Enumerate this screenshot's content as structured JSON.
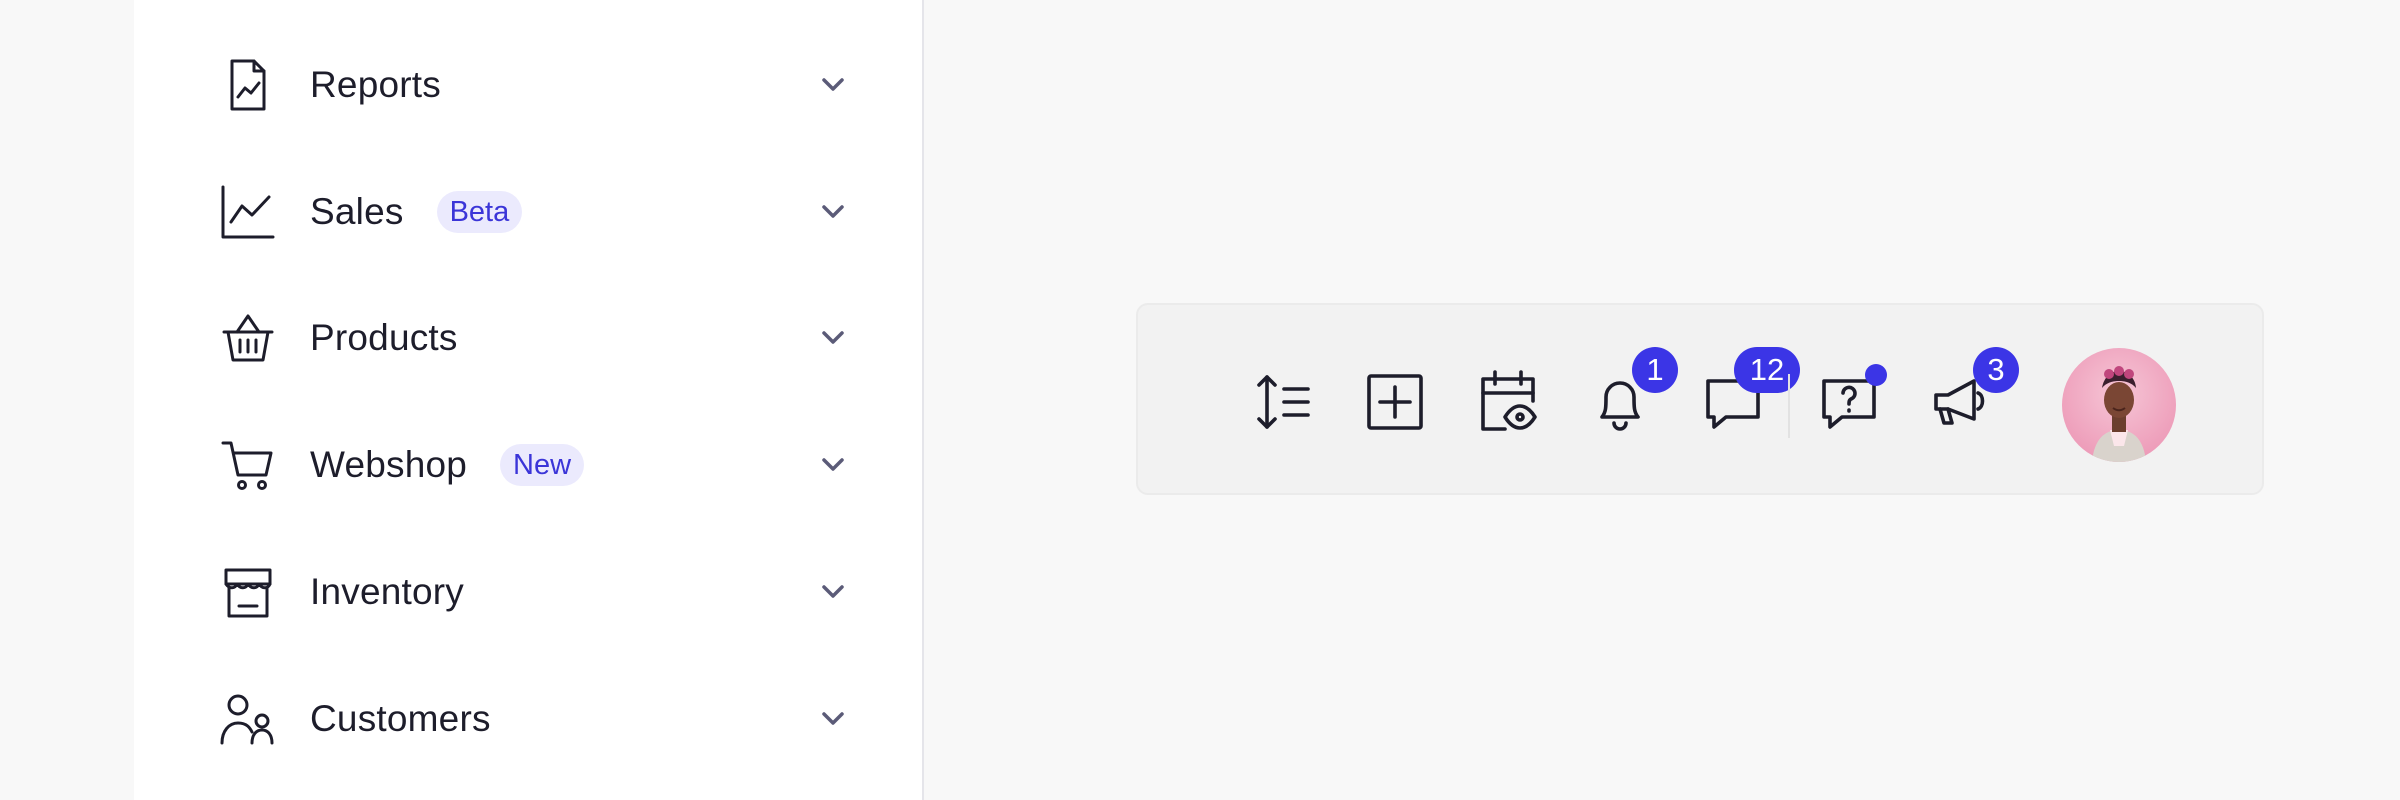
{
  "sidebar": {
    "items": [
      {
        "label": "Reports",
        "icon": "report-document-icon"
      },
      {
        "label": "Sales",
        "icon": "line-chart-icon",
        "badge": "Beta"
      },
      {
        "label": "Products",
        "icon": "basket-icon"
      },
      {
        "label": "Webshop",
        "icon": "shopping-cart-icon",
        "badge": "New"
      },
      {
        "label": "Inventory",
        "icon": "store-icon"
      },
      {
        "label": "Customers",
        "icon": "users-icon"
      }
    ]
  },
  "toolbar": {
    "buttons": [
      {
        "icon": "line-height-icon"
      },
      {
        "icon": "plus-square-icon"
      },
      {
        "icon": "calendar-view-icon"
      },
      {
        "icon": "bell-icon",
        "badge": "1"
      },
      {
        "icon": "chat-icon",
        "badge": "12"
      },
      {
        "icon": "help-chat-icon",
        "dot": true
      },
      {
        "icon": "megaphone-icon",
        "badge": "3"
      }
    ],
    "avatar": {
      "icon": "avatar"
    }
  },
  "colors": {
    "accent": "#3b35e6",
    "badge_bg": "#ebeafd",
    "badge_text": "#3b35d8",
    "text": "#1d1d2b"
  }
}
